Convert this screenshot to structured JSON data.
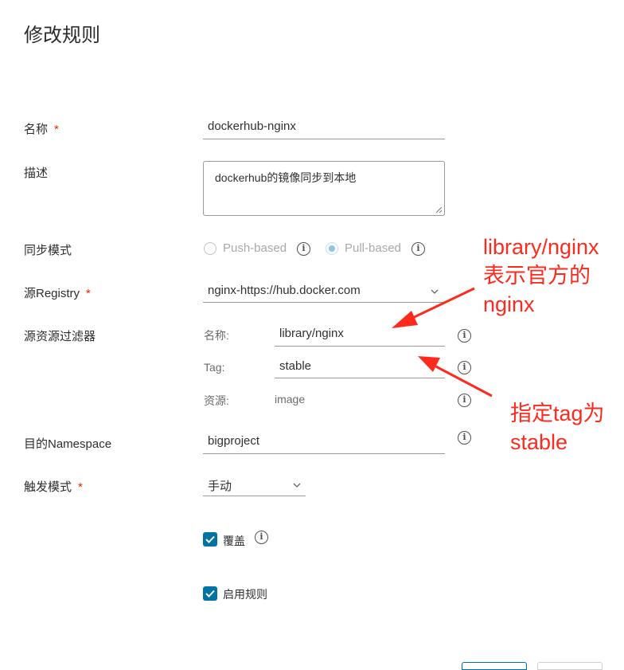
{
  "dialog": {
    "title": "修改规则"
  },
  "form": {
    "name": {
      "label": "名称",
      "required_mark": "*",
      "value": "dockerhub-nginx"
    },
    "description": {
      "label": "描述",
      "value": "dockerhub的镜像同步到本地"
    },
    "sync_mode": {
      "label": "同步模式",
      "options": [
        "Push-based",
        "Pull-based"
      ],
      "selected": "Pull-based"
    },
    "source_registry": {
      "label": "源Registry",
      "required_mark": "*",
      "value": "nginx-https://hub.docker.com"
    },
    "source_filter": {
      "label": "源资源过滤器",
      "name_label": "名称:",
      "name_value": "library/nginx",
      "tag_label": "Tag:",
      "tag_value": "stable",
      "resource_label": "资源:",
      "resource_value": "image"
    },
    "dest_namespace": {
      "label": "目的Namespace",
      "value": "bigproject"
    },
    "trigger_mode": {
      "label": "触发模式",
      "required_mark": "*",
      "value": "手动"
    },
    "override": {
      "label": "覆盖",
      "checked": true
    },
    "enable_rule": {
      "label": "启用规则",
      "checked": true
    }
  },
  "annotations": {
    "top": "library/nginx\n表示官方的\nnginx",
    "bottom": "指定tag为\nstable",
    "color": "#ff2a1e"
  },
  "colors": {
    "accent": "#0072a3",
    "required": "#e62700"
  }
}
